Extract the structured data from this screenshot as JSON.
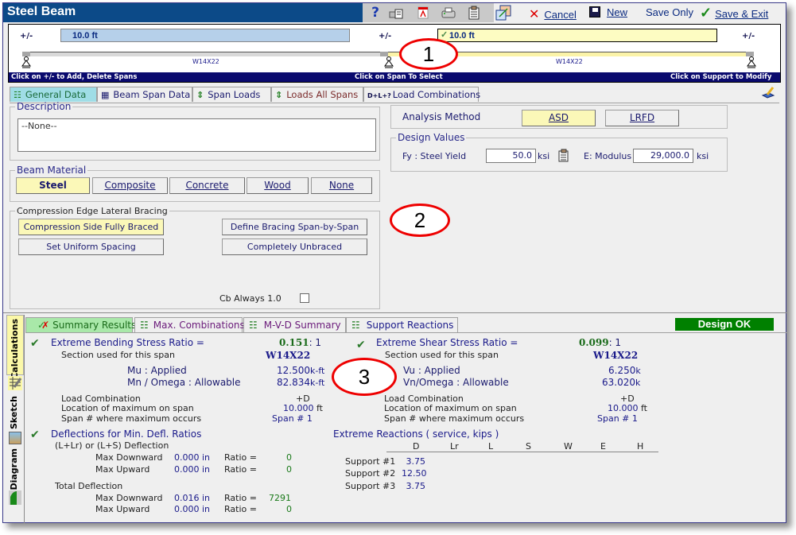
{
  "window": {
    "title": "Steel Beam"
  },
  "toolbar": {
    "icons": [
      "help-icon",
      "print-report-icon",
      "pdf-icon",
      "printer-icon",
      "clipboard-icon",
      "resize-window-icon"
    ],
    "cancel": "Cancel",
    "new": "New",
    "save_only": "Save Only",
    "save_exit": "Save & Exit"
  },
  "span_editor": {
    "add_delete": "+/-",
    "spans": [
      {
        "length": "10.0 ft",
        "section": "W14X22",
        "selected": false
      },
      {
        "length": "10.0 ft",
        "section": "W14X22",
        "selected": true
      }
    ],
    "hints": {
      "left": "Click on  +/-  to Add, Delete Spans",
      "center": "Click on Span To Select",
      "right": "Click on Support to Modify"
    }
  },
  "input_tabs": [
    {
      "label": "General Data",
      "active": true
    },
    {
      "label": "Beam Span Data",
      "active": false
    },
    {
      "label": "Span Loads",
      "active": false
    },
    {
      "label": "Loads All Spans",
      "active": false
    },
    {
      "label": "Load Combinations",
      "active": false,
      "prefix": "D+L+?"
    }
  ],
  "general": {
    "description_label": "Description",
    "description_value": "--None--",
    "beam_material_label": "Beam Material",
    "materials": [
      {
        "label": "Steel",
        "selected": true
      },
      {
        "label": "Composite",
        "selected": false
      },
      {
        "label": "Concrete",
        "selected": false
      },
      {
        "label": "Wood",
        "selected": false
      },
      {
        "label": "None",
        "selected": false
      }
    ],
    "bracing_label": "Compression Edge Lateral Bracing",
    "bracing_buttons": [
      {
        "label": "Compression Side Fully Braced",
        "selected": true
      },
      {
        "label": "Define Bracing Span-by-Span",
        "selected": false
      },
      {
        "label": "Set Uniform Spacing",
        "selected": false
      },
      {
        "label": "Completely Unbraced",
        "selected": false
      }
    ],
    "cb_label": "Cb Always 1.0",
    "cb_checked": false,
    "analysis_method_label": "Analysis Method",
    "analysis_methods": [
      {
        "label": "ASD",
        "selected": true
      },
      {
        "label": "LRFD",
        "selected": false
      }
    ],
    "design_values_label": "Design Values",
    "fy_label": "Fy : Steel Yield",
    "fy_value": "50.0",
    "fy_unit": "ksi",
    "e_label": "E: Modulus",
    "e_value": "29,000.0",
    "e_unit": "ksi"
  },
  "annotations": [
    "1",
    "2",
    "3"
  ],
  "side_tabs": [
    {
      "label": "Calculations",
      "active": true
    },
    {
      "label": "Sketch",
      "active": false
    },
    {
      "label": "Diagram",
      "active": false
    }
  ],
  "result_tabs": [
    {
      "label": "Summary Results",
      "active": true
    },
    {
      "label": "Max. Combinations",
      "active": false
    },
    {
      "label": "M-V-D Summary",
      "active": false
    },
    {
      "label": "Support Reactions",
      "active": false
    }
  ],
  "status": {
    "label": "Design OK",
    "color": "#008000"
  },
  "bending": {
    "title": "Extreme Bending Stress Ratio   =",
    "ratio": "0.151",
    "ratio_suffix": ": 1",
    "section_label": "Section used for this span",
    "section": "W14X22",
    "applied_label": "Mu : Applied",
    "applied_value": "12.500",
    "applied_unit": "k-ft",
    "allow_label": "Mn / Omega : Allowable",
    "allow_value": "82.834",
    "allow_unit": "k-ft",
    "combo_label": "Load Combination",
    "combo_value": "+D",
    "location_label": "Location of maximum on span",
    "location_value": "10.000",
    "location_unit": "ft",
    "span_label": "Span # where maximum occurs",
    "span_value": "Span # 1"
  },
  "shear": {
    "title": "Extreme Shear Stress Ratio =",
    "ratio": "0.099",
    "ratio_suffix": ": 1",
    "section_label": "Section used for this span",
    "section": "W14X22",
    "applied_label": "Vu : Applied",
    "applied_value": "6.250",
    "applied_unit": "k",
    "allow_label": "Vn/Omega : Allowable",
    "allow_value": "63.020",
    "allow_unit": "k",
    "combo_label": "Load Combination",
    "combo_value": "+D",
    "location_label": "Location of maximum on span",
    "location_value": "10.000",
    "location_unit": "ft",
    "span_label": "Span # where maximum occurs",
    "span_value": "Span # 1"
  },
  "deflection": {
    "title": "Deflections for Min. Defl. Ratios",
    "live_label": "(L+Lr) or (L+S) Deflection",
    "total_label": "Total Deflection",
    "ratio_label": "Ratio =",
    "rows": [
      {
        "group": "live",
        "label": "Max Downward",
        "value": "0.000 in",
        "ratio": "0"
      },
      {
        "group": "live",
        "label": "Max Upward",
        "value": "0.000 in",
        "ratio": "0"
      },
      {
        "group": "total",
        "label": "Max Downward",
        "value": "0.016 in",
        "ratio": "7291"
      },
      {
        "group": "total",
        "label": "Max Upward",
        "value": "0.000 in",
        "ratio": "0"
      }
    ]
  },
  "reactions": {
    "title": "Extreme Reactions  ( service,  kips )",
    "columns": [
      "D",
      "Lr",
      "L",
      "S",
      "W",
      "E",
      "H"
    ],
    "rows": [
      {
        "label": "Support #1",
        "D": "3.75"
      },
      {
        "label": "Support #2",
        "D": "12.50"
      },
      {
        "label": "Support #3",
        "D": "3.75"
      }
    ]
  }
}
